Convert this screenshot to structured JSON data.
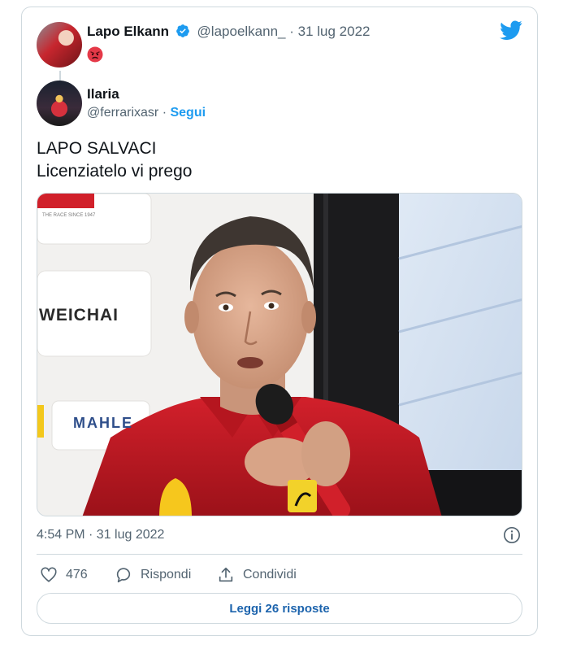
{
  "tweet": {
    "author_name": "Lapo Elkann",
    "author_handle": "@lapoelkann_",
    "separator": "·",
    "author_date": "31 lug 2022",
    "emoji_icon": "angry-face-icon"
  },
  "quoted": {
    "name": "Ilaria",
    "handle": "@ferrarixasr",
    "separator": "·",
    "follow_label": "Segui"
  },
  "text": {
    "line1": "LAPO SALVACI",
    "line2": "Licenziatelo vi prego"
  },
  "media": {
    "sponsor_1": "WEICHAI",
    "sponsor_2": "MAHLE",
    "sponsor_tagline": "THE RACE SINCE 1947"
  },
  "meta": {
    "timestamp": "4:54 PM · 31 lug 2022"
  },
  "actions": {
    "like_count": "476",
    "reply_label": "Rispondi",
    "share_label": "Condividi"
  },
  "footer": {
    "read_replies_label": "Leggi 26 risposte"
  },
  "colors": {
    "accent": "#1d9bf0",
    "link": "#1d64ad",
    "muted": "#536471",
    "border": "#cfd9de",
    "ferrari_red": "#d1202a"
  }
}
